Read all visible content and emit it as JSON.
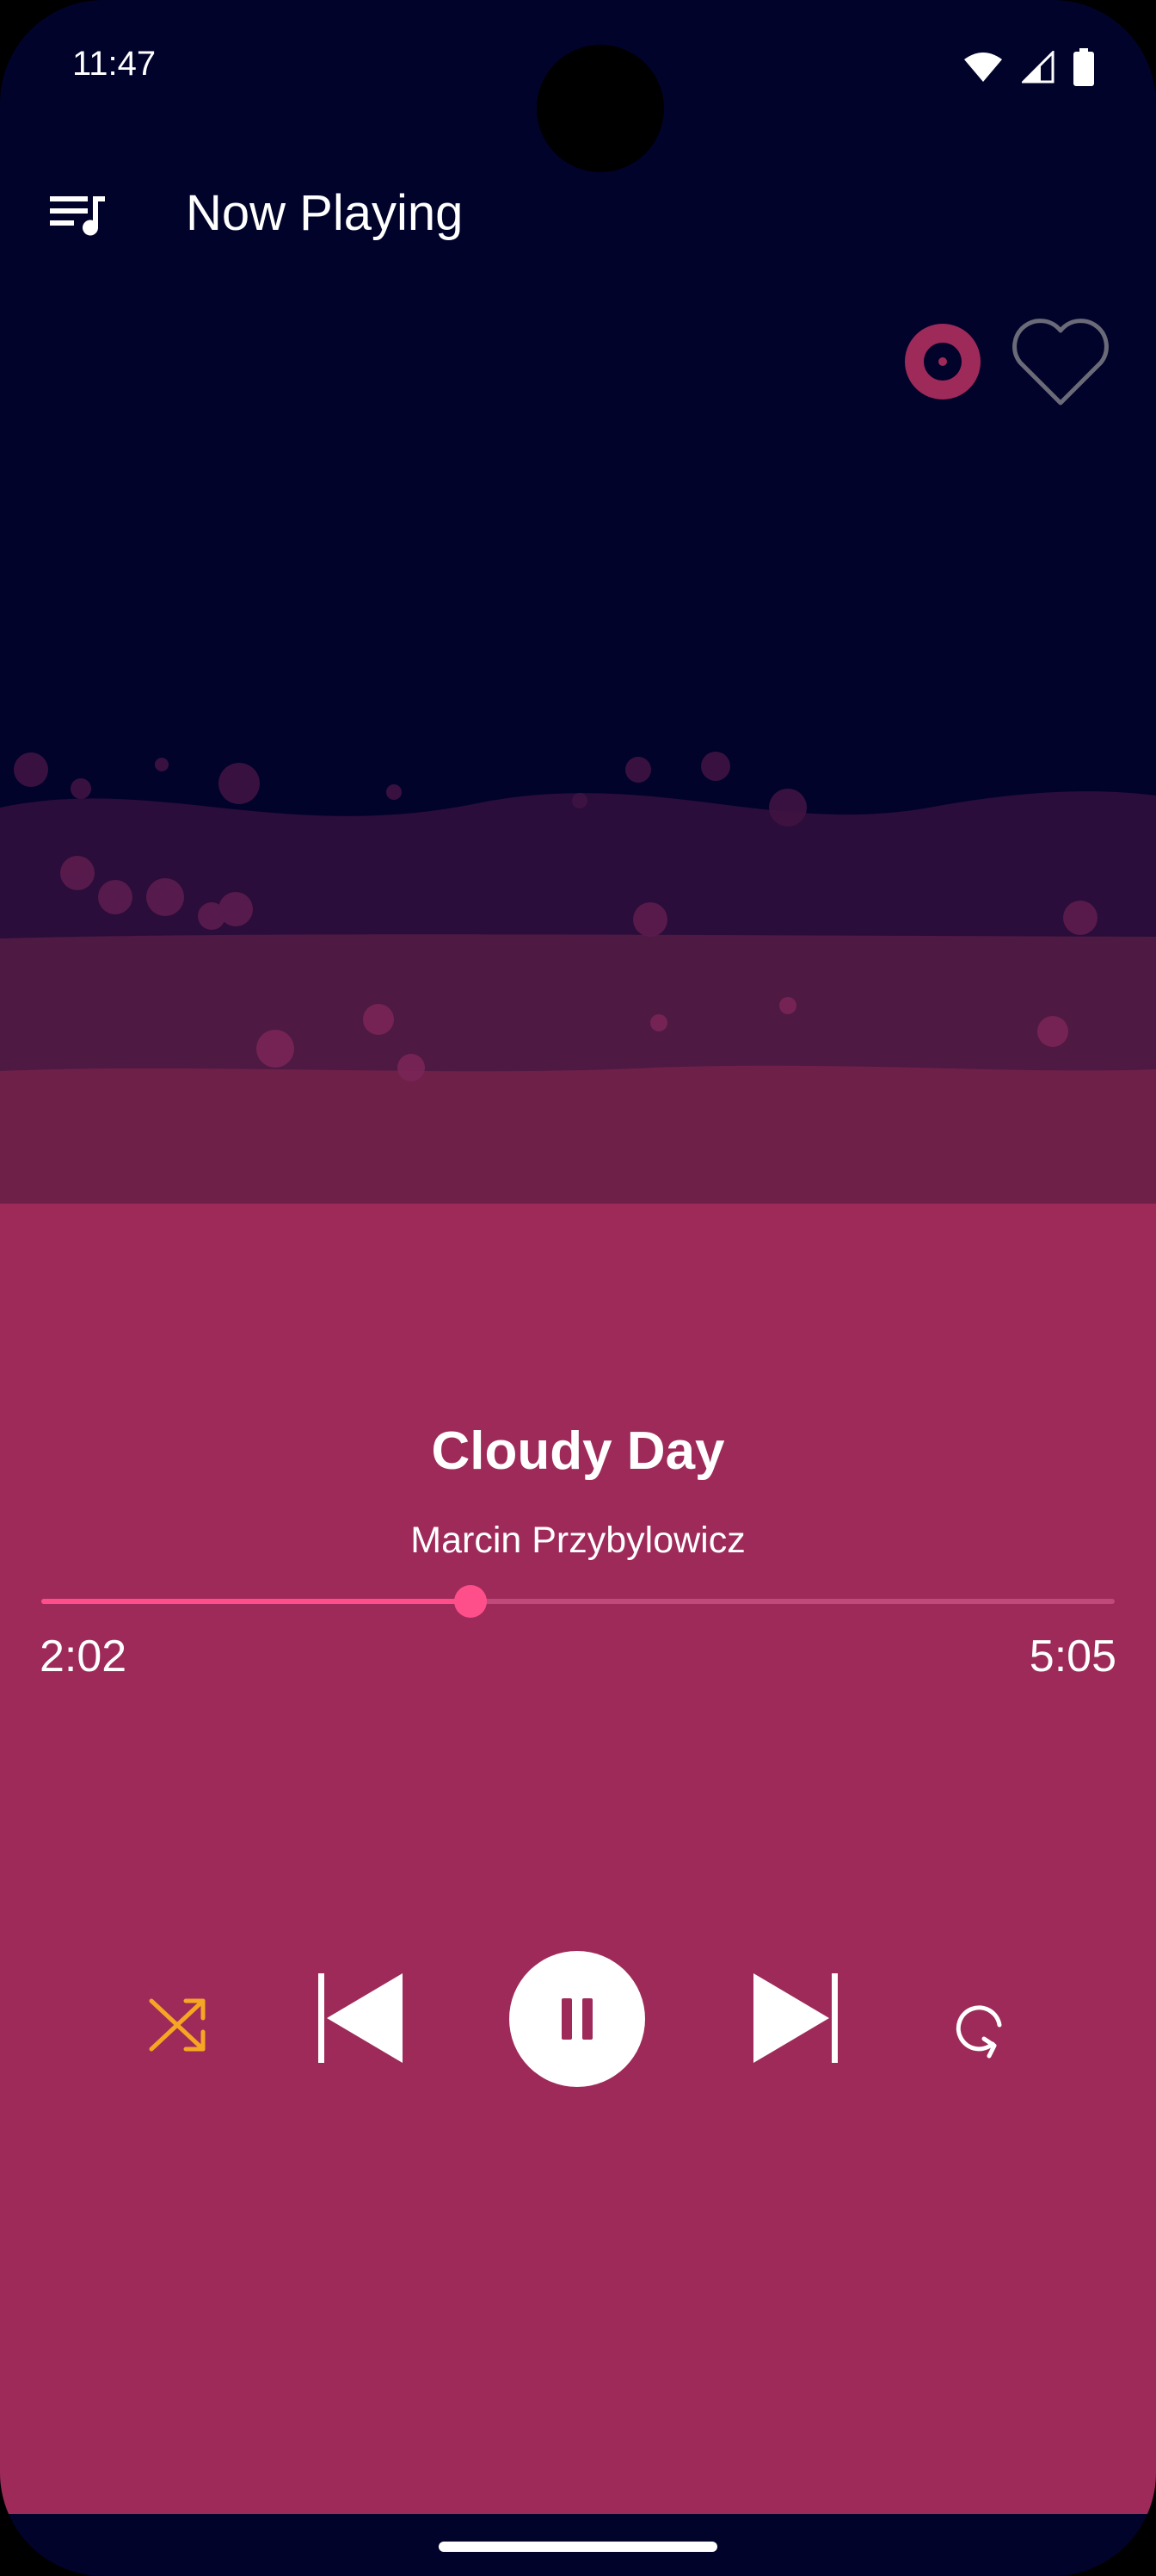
{
  "status_bar": {
    "time": "11:47",
    "icons": [
      "wifi-icon",
      "signal-icon",
      "battery-icon"
    ]
  },
  "app_bar": {
    "title": "Now Playing",
    "menu_icon": "queue-music-icon",
    "vinyl_icon": "vinyl-record-icon",
    "favorite_icon": "heart-outline-icon"
  },
  "track": {
    "title": "Cloudy Day",
    "artist": "Marcin Przybylowicz"
  },
  "progress": {
    "current": "2:02",
    "total": "5:05",
    "fraction": 0.4
  },
  "controls": {
    "shuffle_icon": "shuffle-icon",
    "previous_icon": "skip-previous-icon",
    "pause_icon": "pause-icon",
    "next_icon": "skip-next-icon",
    "repeat_icon": "repeat-icon",
    "shuffle_active": true
  },
  "colors": {
    "background": "#01032a",
    "panel": "#9e2a5a",
    "accent": "#ff4f8b",
    "shuffle_active": "#f5a623",
    "wave_layer_1": "#2a0d3a",
    "wave_layer_2": "#4e1942",
    "wave_layer_3": "#6f2049"
  }
}
